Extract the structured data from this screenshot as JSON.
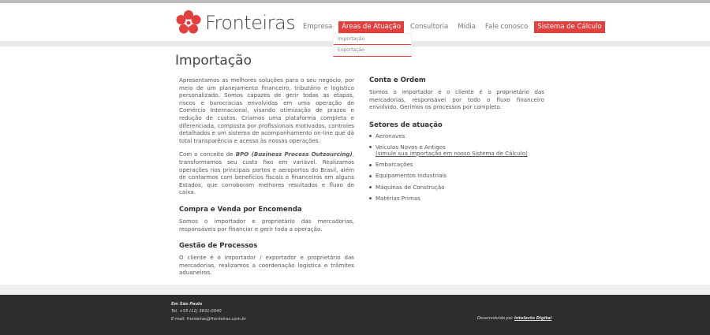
{
  "brand": {
    "name": "Fronteiras",
    "accent": "#e0413e"
  },
  "nav": {
    "items": [
      {
        "label": "Empresa"
      },
      {
        "label": "Áreas de Atuação",
        "active": true
      },
      {
        "label": "Consultoria"
      },
      {
        "label": "Mídia"
      },
      {
        "label": "Fale conosco"
      },
      {
        "label": "Sistema de Cálculo",
        "highlight": true
      }
    ],
    "dropdown": [
      "Importação",
      "Exportação"
    ]
  },
  "page": {
    "title": "Importação",
    "intro_p1": "Apresentamos as melhores soluções para o seu negócio, por meio de um planejamento financeiro, tributário e logístico personalizado. Somos capazes de gerir todas as etapas, riscos e burocracias envolvidas em uma operação de Comércio Internacional, visando otimização de prazos e redução de custos. Criamos uma plataforma completa e diferenciada, composta por profissionais motivados, controles detalhados e um sistema de acompanhamento on-line que dá total transparência e acesso às nossas operações.",
    "intro_p2_before": "Com o conceito de ",
    "intro_p2_em": "BPO (Business Process Outsourcing)",
    "intro_p2_after": ", transformamos seu custo fixo em variável. Realizamos operações nos principais portos e aeroportos do Brasil, além de contarmos com benefícios fiscais e financeiros em alguns Estados, que corroboram melhores resultados e fluxo de caixa.",
    "compra": {
      "title": "Compra e Venda por Encomenda",
      "text": "Somos o importador e proprietário das mercadorias, responsáveis por financiar e gerir toda a operação."
    },
    "gestao": {
      "title": "Gestão de Processos",
      "text": "O cliente é o importador / exportador e proprietário das mercadorias, realizamos a coordenação logística e trâmites aduaneiros."
    },
    "conta": {
      "title": "Conta e Ordem",
      "text": "Somos o importador e o cliente é o proprietário das mercadorias, responsável por todo o fluxo financeiro envolvido. Gerimos os processos por completo."
    },
    "setores": {
      "title": "Setores de atuação",
      "items": [
        "Aeronaves",
        "Veículos Novos e Antigos",
        "Embarcações",
        "Equipamentos Industriais",
        "Máquinas de Construção",
        "Matérias Primas"
      ],
      "sim_link": "(simule sua importação em nosso Sistema de Cálculo)"
    }
  },
  "footer": {
    "city": "Em São Paulo",
    "tel": "Tel. +55 (11) 3831-0040",
    "email": "E-mail: fronteiras@fronteiras.com.br",
    "dev_prefix": "Desenvolvido por ",
    "dev_link": "Intelecto Digital"
  }
}
